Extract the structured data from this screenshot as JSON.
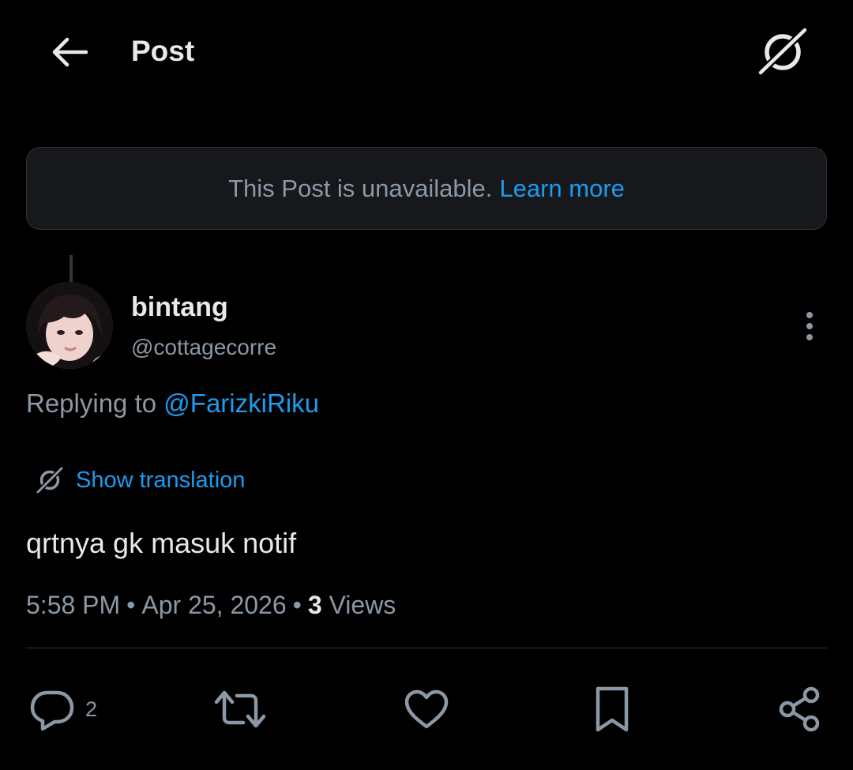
{
  "header": {
    "title": "Post",
    "back_icon": "arrow-left-icon",
    "grok_icon": "grok-icon"
  },
  "notice": {
    "text": "This Post is unavailable.",
    "link": "Learn more"
  },
  "author": {
    "name": "bintang",
    "handle": "@cottagecorre",
    "avatar_icon": "avatar-photo"
  },
  "reply": {
    "prefix": "Replying to",
    "mention": "@FarizkiRiku"
  },
  "translation": {
    "label": "Show translation"
  },
  "post": {
    "text": "qrtnya gk masuk notif",
    "time": "5:58 PM",
    "date": "Apr 25, 2026",
    "views_count": "3",
    "views_label": "Views"
  },
  "actions": {
    "reply_count": "2",
    "icons": [
      "comment-icon",
      "repost-icon",
      "heart-icon",
      "bookmark-icon",
      "share-icon"
    ]
  },
  "colors": {
    "background": "#000000",
    "text": "#e7e9ea",
    "muted": "#8b98a5",
    "accent": "#1d9bf0",
    "border": "#2f3336"
  }
}
